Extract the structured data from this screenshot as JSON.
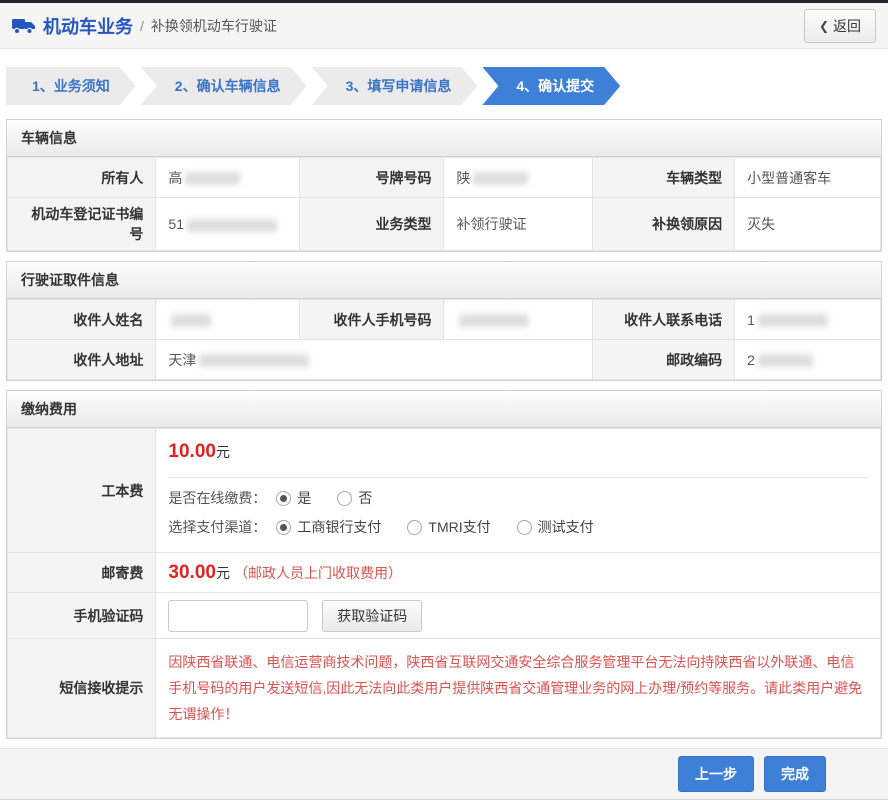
{
  "header": {
    "app_title": "机动车业务",
    "separator": "/",
    "page_title": "补换领机动车行驶证",
    "back_button": "返回",
    "back_chevron_icon": "❮"
  },
  "steps": {
    "step1": "1、业务须知",
    "step2": "2、确认车辆信息",
    "step3": "3、填写申请信息",
    "step4": "4、确认提交",
    "active_step": "4、确认提交"
  },
  "vehicle_info": {
    "section_title": "车辆信息",
    "owner_label": "所有人",
    "owner_value_prefix": "高",
    "plate_label": "号牌号码",
    "plate_value_prefix": "陕",
    "vehicle_type_label": "车辆类型",
    "vehicle_type_value": "小型普通客车",
    "cert_no_label": "机动车登记证书编号",
    "cert_no_value_prefix": "51",
    "business_type_label": "业务类型",
    "business_type_value": "补领行驶证",
    "reason_label": "补换领原因",
    "reason_value": "灭失"
  },
  "pickup_info": {
    "section_title": "行驶证取件信息",
    "name_label": "收件人姓名",
    "mobile_label": "收件人手机号码",
    "phone_label": "收件人联系电话",
    "phone_value_prefix": "1",
    "address_label": "收件人地址",
    "address_value_prefix": "天津",
    "postcode_label": "邮政编码",
    "postcode_value_prefix": "2"
  },
  "payment": {
    "section_title": "缴纳费用",
    "fee_label": "工本费",
    "fee_amount": "10.00",
    "fee_unit": "元",
    "online_pay_label": "是否在线缴费：",
    "online_yes": "是",
    "online_no": "否",
    "online_selected": "是",
    "channel_label": "选择支付渠道：",
    "channel_icbc": "工商银行支付",
    "channel_tmri": "TMRI支付",
    "channel_test": "测试支付",
    "channel_selected": "工商银行支付",
    "postage_label": "邮寄费",
    "postage_amount": "30.00",
    "postage_unit": "元",
    "postage_note": "（邮政人员上门收取费用）",
    "captcha_label": "手机验证码",
    "captcha_value": "",
    "captcha_button": "获取验证码",
    "sms_label": "短信接收提示",
    "sms_note": "因陕西省联通、电信运营商技术问题，陕西省互联网交通安全综合服务管理平台无法向持陕西省以外联通、电信手机号码的用户发送短信,因此无法向此类用户提供陕西省交通管理业务的网上办理/预约等服务。请此类用户避免无谓操作！"
  },
  "footer": {
    "prev_button": "上一步",
    "finish_button": "完成"
  },
  "colors": {
    "accent_blue": "#3e80d8",
    "title_blue": "#2456c0",
    "step_text_blue": "#3a74c8",
    "amount_red": "#e02222",
    "note_red": "#d9534f",
    "top_strip": "#24272c"
  }
}
